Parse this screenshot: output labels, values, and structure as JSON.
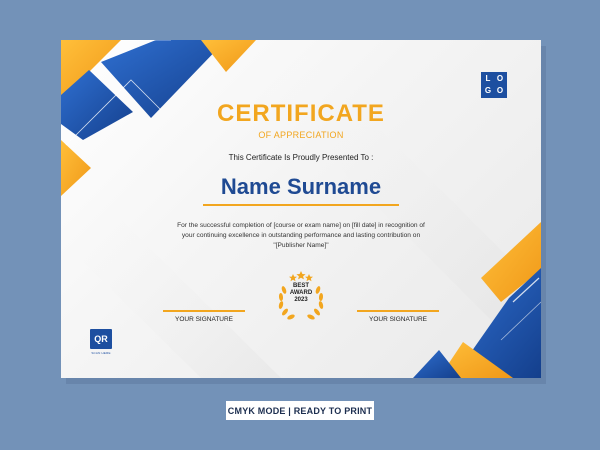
{
  "certificate": {
    "logo_letters": [
      "L",
      "O",
      "G",
      "O"
    ],
    "title": "CERTIFICATE",
    "subtitle": "OF APPRECIATION",
    "presented_text": "This Certificate Is Proudly Presented To :",
    "recipient_name": "Name Surname",
    "description_lines": [
      "For the successful completion of [course or exam name] on [fill date] in recognition of",
      "your continuing excellence in outstanding performance and lasting contribution on",
      "\"[Publisher Name]\""
    ],
    "signature_left_label": "YOUR SIGNATURE",
    "signature_right_label": "YOUR SIGNATURE",
    "award": {
      "line1": "BEST",
      "line2": "AWARD",
      "line3": "2023",
      "stars": 3
    },
    "qr_label": "QR",
    "qr_caption": "SCAN HERE"
  },
  "footer": {
    "badge_text": "CMYK MODE | READY TO PRINT"
  },
  "colors": {
    "background": "#7392b8",
    "accent_orange": "#f2a61f",
    "accent_blue": "#1d4fa0",
    "name_blue": "#1f4a93"
  }
}
